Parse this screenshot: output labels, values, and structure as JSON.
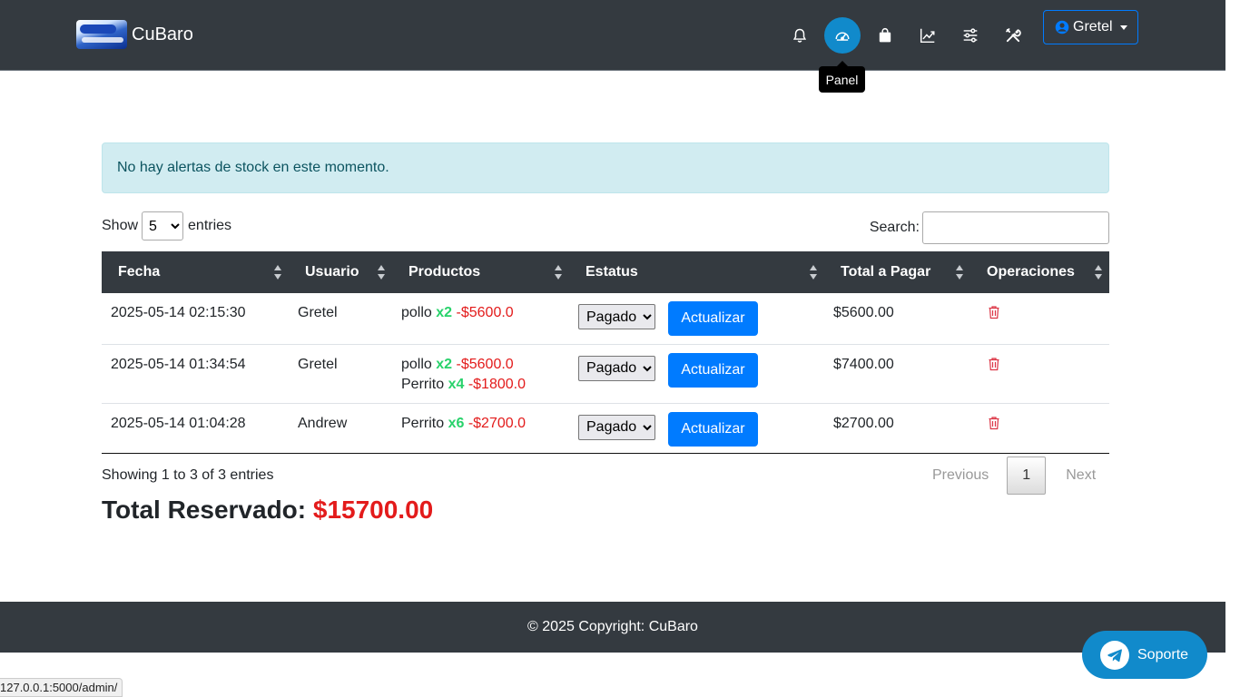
{
  "navbar": {
    "brand": "CuBaro",
    "icons": [
      "bell-icon",
      "speedometer-icon",
      "bag-icon",
      "chart-line-icon",
      "sliders-icon",
      "tools-icon"
    ],
    "tooltip": "Panel",
    "user": "Gretel"
  },
  "alert": {
    "text": "No hay alertas de stock en este momento."
  },
  "controls": {
    "show_label": "Show",
    "entries_value": "5",
    "entries_label": "entries",
    "search_label": "Search:",
    "search_value": ""
  },
  "table": {
    "headers": [
      "Fecha",
      "Usuario",
      "Productos",
      "Estatus",
      "Total a Pagar",
      "Operaciones"
    ],
    "status_button": "Actualizar",
    "rows": [
      {
        "fecha": "2025-05-14 02:15:30",
        "usuario": "Gretel",
        "productos": [
          {
            "name": "pollo",
            "qty": "x2",
            "price": "-$5600.0"
          }
        ],
        "estatus": "Pagado",
        "total": "$5600.00"
      },
      {
        "fecha": "2025-05-14 01:34:54",
        "usuario": "Gretel",
        "productos": [
          {
            "name": "pollo",
            "qty": "x2",
            "price": "-$5600.0"
          },
          {
            "name": "Perrito",
            "qty": "x4",
            "price": "-$1800.0"
          }
        ],
        "estatus": "Pagado",
        "total": "$7400.00"
      },
      {
        "fecha": "2025-05-14 01:04:28",
        "usuario": "Andrew",
        "productos": [
          {
            "name": "Perrito",
            "qty": "x6",
            "price": "-$2700.0"
          }
        ],
        "estatus": "Pagado",
        "total": "$2700.00"
      }
    ]
  },
  "info": {
    "showing": "Showing 1 to 3 of 3 entries",
    "previous": "Previous",
    "page": "1",
    "next": "Next"
  },
  "total": {
    "label": "Total Reservado:",
    "amount": "$15700.00"
  },
  "footer": {
    "text": "© 2025 Copyright: CuBaro"
  },
  "support": {
    "label": "Soporte"
  },
  "status_bar": {
    "url": "127.0.0.1:5000/admin/"
  },
  "colors": {
    "navbar": "#343a40",
    "primary": "#007bff",
    "accent": "#118acb",
    "qty": "#28d26b",
    "price": "#e31b1b"
  }
}
